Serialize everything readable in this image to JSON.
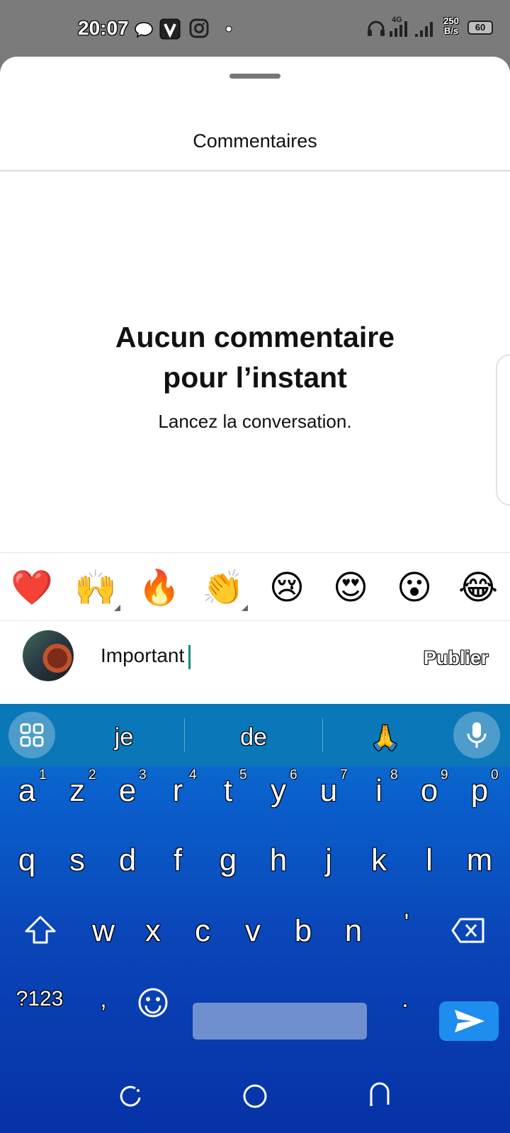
{
  "status_bar": {
    "time": "20:07",
    "network_type": "4G",
    "speed_value": "250",
    "speed_unit": "B/s",
    "battery": "60",
    "icons": [
      "chat-bubble-icon",
      "v-app-icon",
      "instagram-icon",
      "dot-icon",
      "headphones-icon",
      "signal-4g-icon",
      "signal-icon",
      "battery-icon"
    ]
  },
  "sheet": {
    "title": "Commentaires",
    "empty_title_line1": "Aucun commentaire",
    "empty_title_line2": "pour l’instant",
    "empty_subtitle": "Lancez la conversation."
  },
  "quick_reactions": [
    "❤️",
    "🙌",
    "🔥",
    "👏",
    "😢",
    "😍",
    "😮",
    "😂"
  ],
  "composer": {
    "text": "Important",
    "publish_label": "Publier"
  },
  "keyboard": {
    "suggestions": [
      "je",
      "de",
      "🙏"
    ],
    "row1": [
      "a",
      "z",
      "e",
      "r",
      "t",
      "y",
      "u",
      "i",
      "o",
      "p"
    ],
    "row1_hints": [
      "1",
      "2",
      "3",
      "4",
      "5",
      "6",
      "7",
      "8",
      "9",
      "0"
    ],
    "row2": [
      "q",
      "s",
      "d",
      "f",
      "g",
      "h",
      "j",
      "k",
      "l",
      "m"
    ],
    "row3": [
      "w",
      "x",
      "c",
      "v",
      "b",
      "n",
      "'"
    ],
    "symbols_key": "?123",
    "comma_key": ",",
    "period_key": "."
  },
  "colors": {
    "caret": "#0b8b7e",
    "keyboard_top": "#0a78cc",
    "keyboard_bottom": "#0632a6",
    "send_button": "#1e8df0"
  }
}
